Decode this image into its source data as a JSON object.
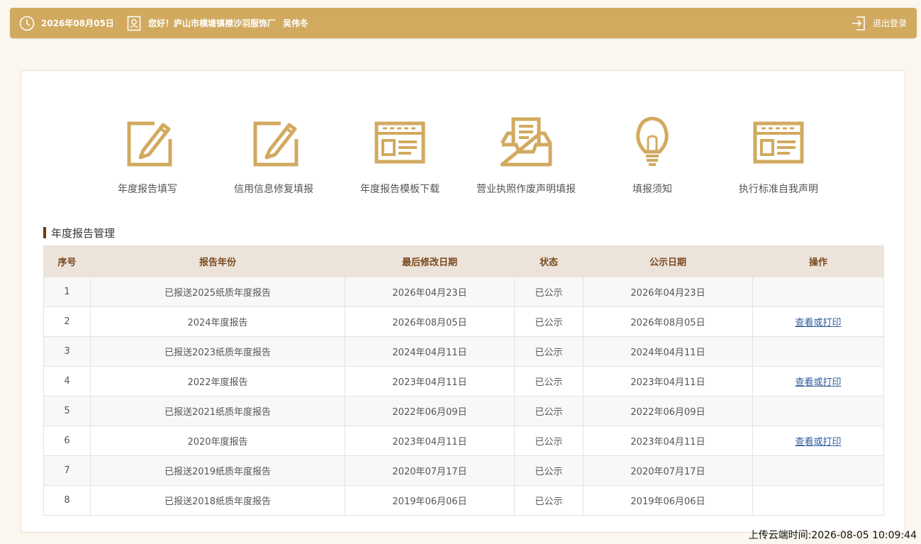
{
  "topbar": {
    "date": "2026年08月05日",
    "greeting": "您好！庐山市横塘镇襟沙羽服饰厂",
    "user": "吴伟冬",
    "logout_label": "退出登录",
    "clock_icon": "clock-icon",
    "user_icon": "user-badge-icon",
    "logout_icon": "logout-icon"
  },
  "colors": {
    "accent": "#d1aa60",
    "header_bg": "#ece3da",
    "header_text": "#7a4a1f",
    "link": "#2f5a9e",
    "section_bar": "#6f3a0e"
  },
  "shortcuts": [
    {
      "label": "年度报告填写",
      "icon": "edit-form-icon"
    },
    {
      "label": "信用信息修复填报",
      "icon": "edit-form-icon"
    },
    {
      "label": "年度报告模板下载",
      "icon": "template-window-icon"
    },
    {
      "label": "营业执照作废声明填报",
      "icon": "inbox-document-icon"
    },
    {
      "label": "填报须知",
      "icon": "lightbulb-icon"
    },
    {
      "label": "执行标准自我声明",
      "icon": "template-window-icon"
    }
  ],
  "section": {
    "title": "年度报告管理"
  },
  "table": {
    "columns": [
      "序号",
      "报告年份",
      "最后修改日期",
      "状态",
      "公示日期",
      "操作"
    ],
    "rows": [
      {
        "no": "1",
        "year": "已报送2025纸质年度报告",
        "modified": "2026年04月23日",
        "status": "已公示",
        "published": "2026年04月23日",
        "action": ""
      },
      {
        "no": "2",
        "year": "2024年度报告",
        "modified": "2026年08月05日",
        "status": "已公示",
        "published": "2026年08月05日",
        "action": "查看或打印"
      },
      {
        "no": "3",
        "year": "已报送2023纸质年度报告",
        "modified": "2024年04月11日",
        "status": "已公示",
        "published": "2024年04月11日",
        "action": ""
      },
      {
        "no": "4",
        "year": "2022年度报告",
        "modified": "2023年04月11日",
        "status": "已公示",
        "published": "2023年04月11日",
        "action": "查看或打印"
      },
      {
        "no": "5",
        "year": "已报送2021纸质年度报告",
        "modified": "2022年06月09日",
        "status": "已公示",
        "published": "2022年06月09日",
        "action": ""
      },
      {
        "no": "6",
        "year": "2020年度报告",
        "modified": "2023年04月11日",
        "status": "已公示",
        "published": "2023年04月11日",
        "action": "查看或打印"
      },
      {
        "no": "7",
        "year": "已报送2019纸质年度报告",
        "modified": "2020年07月17日",
        "status": "已公示",
        "published": "2020年07月17日",
        "action": ""
      },
      {
        "no": "8",
        "year": "已报送2018纸质年度报告",
        "modified": "2019年06月06日",
        "status": "已公示",
        "published": "2019年06月06日",
        "action": ""
      }
    ]
  },
  "footer": {
    "upload_time": "上传云端时间:2026-08-05 10:09:44"
  }
}
